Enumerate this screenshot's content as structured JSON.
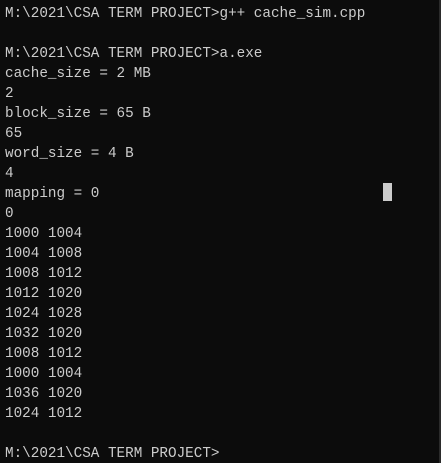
{
  "terminal": {
    "lines": [
      "M:\\2021\\CSA TERM PROJECT>g++ cache_sim.cpp",
      "",
      "M:\\2021\\CSA TERM PROJECT>a.exe",
      "cache_size = 2 MB",
      "2",
      "block_size = 65 B",
      "65",
      "word_size = 4 B",
      "4",
      "mapping = 0",
      "0",
      "1000 1004",
      "1004 1008",
      "1008 1012",
      "1012 1020",
      "1024 1028",
      "1032 1020",
      "1008 1012",
      "1000 1004",
      "1036 1020",
      "1024 1012",
      "",
      "M:\\2021\\CSA TERM PROJECT>"
    ]
  },
  "colors": {
    "background": "#0c0c0c",
    "foreground": "#cccccc"
  }
}
